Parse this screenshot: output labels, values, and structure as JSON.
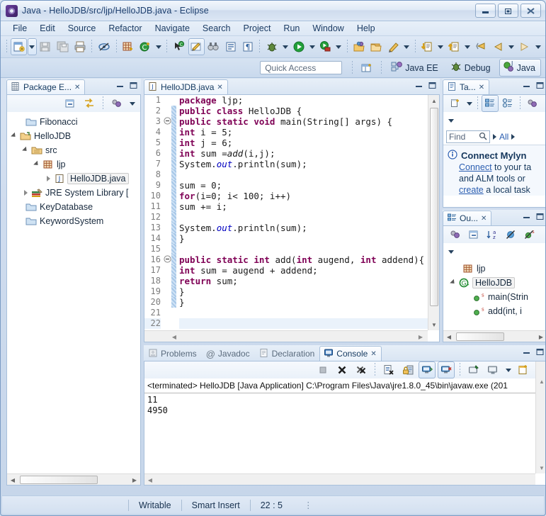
{
  "window": {
    "title": "Java - HelloJDB/src/ljp/HelloJDB.java - Eclipse",
    "app_icon": "eclipse-icon",
    "buttons": {
      "minimize": "Minimize",
      "restore": "Restore",
      "close": "Close"
    }
  },
  "menubar": {
    "items": [
      "File",
      "Edit",
      "Source",
      "Refactor",
      "Navigate",
      "Search",
      "Project",
      "Run",
      "Window",
      "Help"
    ]
  },
  "toolbar": {
    "groups": [
      {
        "items": [
          {
            "name": "new-wizard-icon",
            "glyph": "new",
            "dropdown": true
          },
          {
            "name": "save-icon",
            "glyph": "save",
            "disabled": true
          },
          {
            "name": "save-all-icon",
            "glyph": "saveall",
            "disabled": true
          },
          {
            "name": "print-icon",
            "glyph": "print"
          }
        ]
      },
      {
        "items": [
          {
            "name": "toggle-mark-occurrences-icon",
            "glyph": "occurrences"
          }
        ]
      },
      {
        "items": [
          {
            "name": "new-java-package-icon",
            "glyph": "package"
          },
          {
            "name": "new-java-class-icon",
            "glyph": "class",
            "dropdown": true
          }
        ]
      },
      {
        "items": [
          {
            "name": "open-type-icon",
            "glyph": "opentype"
          },
          {
            "name": "edit-icon",
            "glyph": "edit",
            "pressed": true
          },
          {
            "name": "search-icon",
            "glyph": "binoculars"
          },
          {
            "name": "show-whitespace-icon",
            "glyph": "whitespace"
          },
          {
            "name": "pilcrow-icon",
            "glyph": "pilcrow"
          }
        ]
      },
      {
        "items": [
          {
            "name": "debug-icon",
            "glyph": "bug",
            "dropdown": true
          },
          {
            "name": "run-icon",
            "glyph": "run",
            "dropdown": true
          },
          {
            "name": "run-external-tools-icon",
            "glyph": "exttools",
            "dropdown": true
          }
        ]
      },
      {
        "items": [
          {
            "name": "open-task-icon",
            "glyph": "taskopen"
          },
          {
            "name": "activate-task-icon",
            "glyph": "taskfolder"
          },
          {
            "name": "new-task-icon",
            "glyph": "pencil",
            "dropdown": true
          }
        ]
      },
      {
        "items": [
          {
            "name": "previous-annotation-icon",
            "glyph": "prevanno",
            "dropdown": true
          },
          {
            "name": "next-annotation-icon",
            "glyph": "nextanno",
            "dropdown": true
          },
          {
            "name": "last-edit-location-icon",
            "glyph": "lastedit"
          },
          {
            "name": "back-icon",
            "glyph": "back",
            "dropdown": true
          },
          {
            "name": "forward-icon",
            "glyph": "forward",
            "dropdown": true
          }
        ]
      }
    ]
  },
  "perspective_bar": {
    "quick_access_placeholder": "Quick Access",
    "open_perspective_icon": "open-perspective-icon",
    "perspectives": [
      {
        "label": "Java EE",
        "icon": "java-ee-icon",
        "active": false
      },
      {
        "label": "Debug",
        "icon": "debug-perspective-icon",
        "active": false
      },
      {
        "label": "Java",
        "icon": "java-perspective-icon",
        "active": true
      }
    ]
  },
  "package_explorer": {
    "tab_label": "Package E...",
    "tab_icon": "package-explorer-icon",
    "toolbar": [
      {
        "name": "collapse-all-icon"
      },
      {
        "name": "link-with-editor-icon"
      },
      {
        "name": "view-menu-filters-icon"
      },
      {
        "name": "view-menu-icon"
      }
    ],
    "tree": [
      {
        "label": "Fibonacci",
        "icon": "project-closed-icon",
        "indent": 0,
        "twisty": "none",
        "selected": false
      },
      {
        "label": "HelloJDB",
        "icon": "project-open-icon",
        "indent": 0,
        "twisty": "open",
        "selected": false
      },
      {
        "label": "src",
        "icon": "source-folder-icon",
        "indent": 1,
        "twisty": "open",
        "selected": false
      },
      {
        "label": "ljp",
        "icon": "package-icon",
        "indent": 2,
        "twisty": "open",
        "selected": false
      },
      {
        "label": "HelloJDB.java",
        "icon": "java-file-icon",
        "indent": 3,
        "twisty": "closed",
        "selected": true
      },
      {
        "label": "JRE System Library [",
        "icon": "jre-library-icon",
        "indent": 1,
        "twisty": "closed",
        "selected": false
      },
      {
        "label": "KeyDatabase",
        "icon": "project-closed-icon",
        "indent": 0,
        "twisty": "none",
        "selected": false
      },
      {
        "label": "KeywordSystem",
        "icon": "project-closed-icon",
        "indent": 0,
        "twisty": "none",
        "selected": false
      }
    ]
  },
  "editor": {
    "tab_label": "HelloJDB.java",
    "tab_icon": "java-file-icon",
    "tab_close": "✕",
    "lines": [
      {
        "n": 1,
        "fold": false,
        "tokens": [
          {
            "t": "kw",
            "v": "package"
          },
          {
            "t": "p",
            "v": " ljp;"
          }
        ]
      },
      {
        "n": 2,
        "fold": false,
        "tokens": [
          {
            "t": "kw",
            "v": "public class"
          },
          {
            "t": "p",
            "v": " HelloJDB {"
          }
        ]
      },
      {
        "n": 3,
        "fold": true,
        "tokens": [
          {
            "t": "kw",
            "v": "public static void"
          },
          {
            "t": "p",
            "v": " main(String[] args) {"
          }
        ]
      },
      {
        "n": 4,
        "fold": false,
        "tokens": [
          {
            "t": "kw",
            "v": "int"
          },
          {
            "t": "p",
            "v": " i = 5;"
          }
        ]
      },
      {
        "n": 5,
        "fold": false,
        "tokens": [
          {
            "t": "kw",
            "v": "int"
          },
          {
            "t": "p",
            "v": " j = 6;"
          }
        ]
      },
      {
        "n": 6,
        "fold": false,
        "tokens": [
          {
            "t": "kw",
            "v": "int"
          },
          {
            "t": "p",
            "v": " sum ="
          },
          {
            "t": "mth",
            "v": "add"
          },
          {
            "t": "p",
            "v": "(i,j);"
          }
        ]
      },
      {
        "n": 7,
        "fold": false,
        "tokens": [
          {
            "t": "p",
            "v": "System."
          },
          {
            "t": "fld",
            "v": "out"
          },
          {
            "t": "p",
            "v": ".println(sum);"
          }
        ]
      },
      {
        "n": 8,
        "fold": false,
        "tokens": [
          {
            "t": "p",
            "v": ""
          }
        ]
      },
      {
        "n": 9,
        "fold": false,
        "tokens": [
          {
            "t": "p",
            "v": "sum = 0;"
          }
        ]
      },
      {
        "n": 10,
        "fold": false,
        "tokens": [
          {
            "t": "kw",
            "v": "for"
          },
          {
            "t": "p",
            "v": "(i=0; i< 100; i++)"
          }
        ]
      },
      {
        "n": 11,
        "fold": false,
        "tokens": [
          {
            "t": "p",
            "v": "sum += i;"
          }
        ]
      },
      {
        "n": 12,
        "fold": false,
        "tokens": [
          {
            "t": "p",
            "v": ""
          }
        ]
      },
      {
        "n": 13,
        "fold": false,
        "tokens": [
          {
            "t": "p",
            "v": "System."
          },
          {
            "t": "fld",
            "v": "out"
          },
          {
            "t": "p",
            "v": ".println(sum);"
          }
        ]
      },
      {
        "n": 14,
        "fold": false,
        "tokens": [
          {
            "t": "p",
            "v": "}"
          }
        ]
      },
      {
        "n": 15,
        "fold": false,
        "tokens": [
          {
            "t": "p",
            "v": ""
          }
        ]
      },
      {
        "n": 16,
        "fold": true,
        "tokens": [
          {
            "t": "kw",
            "v": "public static int"
          },
          {
            "t": "p",
            "v": " add("
          },
          {
            "t": "kw",
            "v": "int"
          },
          {
            "t": "p",
            "v": " augend, "
          },
          {
            "t": "kw",
            "v": "int"
          },
          {
            "t": "p",
            "v": " addend){"
          }
        ]
      },
      {
        "n": 17,
        "fold": false,
        "tokens": [
          {
            "t": "kw",
            "v": "int"
          },
          {
            "t": "p",
            "v": " sum = augend + addend;"
          }
        ]
      },
      {
        "n": 18,
        "fold": false,
        "tokens": [
          {
            "t": "kw",
            "v": "return"
          },
          {
            "t": "p",
            "v": " sum;"
          }
        ]
      },
      {
        "n": 19,
        "fold": false,
        "tokens": [
          {
            "t": "p",
            "v": "}"
          }
        ]
      },
      {
        "n": 20,
        "fold": false,
        "tokens": [
          {
            "t": "p",
            "v": "}"
          }
        ]
      },
      {
        "n": 21,
        "fold": false,
        "tokens": [
          {
            "t": "p",
            "v": ""
          }
        ]
      },
      {
        "n": 22,
        "fold": false,
        "current": true,
        "tokens": [
          {
            "t": "p",
            "v": ""
          }
        ]
      }
    ]
  },
  "task_list": {
    "tab_label": "Ta...",
    "tab_icon": "task-list-icon",
    "toolbar": [
      {
        "name": "new-task-icon"
      },
      {
        "name": "new-task-dropdown-icon"
      },
      {
        "name": "categorized-presentation-icon",
        "pressed": true
      },
      {
        "name": "scheduled-presentation-icon"
      },
      {
        "name": "focus-on-workweek-icon"
      },
      {
        "name": "view-menu-icon"
      }
    ],
    "find_placeholder": "Find",
    "search_icon": "search-icon",
    "filter_label": "All",
    "message": {
      "icon": "info-icon",
      "title": "Connect Mylyn",
      "lines": [
        [
          {
            "t": "link",
            "v": "Connect"
          },
          {
            "t": "text",
            "v": " to your ta"
          }
        ],
        [
          {
            "t": "text",
            "v": "and ALM tools or"
          }
        ],
        [
          {
            "t": "link",
            "v": "create"
          },
          {
            "t": "text",
            "v": " a local task"
          }
        ]
      ]
    }
  },
  "outline": {
    "tab_label": "Ou...",
    "tab_icon": "outline-icon",
    "toolbar": [
      {
        "name": "focus-on-active-task-icon"
      },
      {
        "name": "collapse-all-icon"
      },
      {
        "name": "sort-icon"
      },
      {
        "name": "hide-fields-icon"
      },
      {
        "name": "hide-static-icon"
      },
      {
        "name": "hide-nonpublic-icon"
      }
    ],
    "tree": [
      {
        "label": "ljp",
        "icon": "package-icon",
        "indent": 1,
        "twisty": "none",
        "selected": false
      },
      {
        "label": "HelloJDB",
        "icon": "class-icon",
        "indent": 0,
        "twisty": "open",
        "selected": true
      },
      {
        "label": "main(Strin",
        "icon": "method-public-static-icon",
        "indent": 2,
        "twisty": "none",
        "selected": false
      },
      {
        "label": "add(int, i",
        "icon": "method-public-static-icon",
        "indent": 2,
        "twisty": "none",
        "selected": false
      }
    ]
  },
  "bottom_panel": {
    "tabs": [
      {
        "label": "Problems",
        "icon": "problems-icon",
        "active": false
      },
      {
        "label": "Javadoc",
        "icon": "javadoc-icon",
        "active": false
      },
      {
        "label": "Declaration",
        "icon": "declaration-icon",
        "active": false
      },
      {
        "label": "Console",
        "icon": "console-icon",
        "active": true
      }
    ],
    "toolbar": [
      {
        "name": "terminate-icon",
        "disabled": true
      },
      {
        "name": "remove-launch-icon"
      },
      {
        "name": "remove-all-terminated-icon"
      },
      {
        "name": "clear-console-icon"
      },
      {
        "name": "scroll-lock-icon"
      },
      {
        "name": "show-console-on-output-icon",
        "pressed": true
      },
      {
        "name": "show-console-on-error-icon",
        "pressed": true
      },
      {
        "name": "pin-console-icon"
      },
      {
        "name": "display-selected-console-icon",
        "dropdown": true
      },
      {
        "name": "open-console-icon",
        "dropdown": true
      }
    ],
    "launch_header": "<terminated> HelloJDB [Java Application] C:\\Program Files\\Java\\jre1.8.0_45\\bin\\javaw.exe (201",
    "output_lines": [
      "11",
      "4950"
    ]
  },
  "statusbar": {
    "writable": "Writable",
    "insert_mode": "Smart Insert",
    "cursor_position": "22 : 5"
  },
  "colors": {
    "keyword": "#7f0055",
    "field": "#0000c0",
    "link": "#2a5db0",
    "title": "#1d3f6e",
    "chrome": "#cfdcee"
  }
}
